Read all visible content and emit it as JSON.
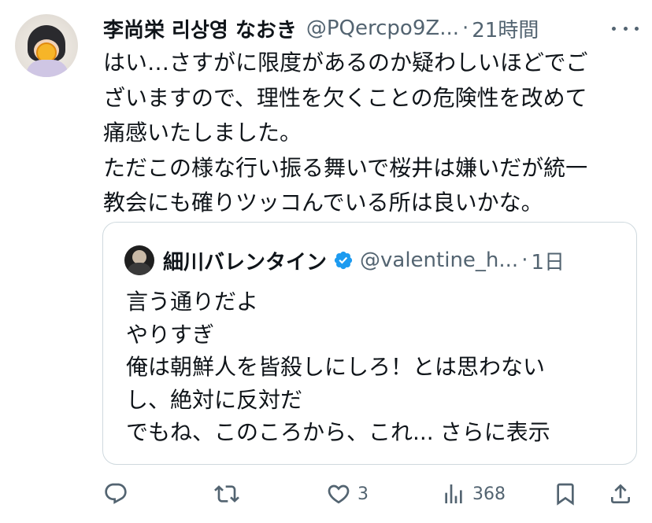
{
  "tweet": {
    "author_name": "李尚栄 리상영 なおき",
    "author_handle": "@PQercpo9Z...",
    "separator": "·",
    "time": "21時間",
    "text": "はい…さすがに限度があるのか疑わしいほどでご\nざいますので、理性を欠くことの危険性を改めて\n痛感いたしました。\nただこの様な行い振る舞いで桜井は嫌いだが統一\n教会にも確りツッコんでいる所は良いかな。"
  },
  "quote": {
    "author_name": "細川バレンタイン",
    "author_handle": "@valentine_h...",
    "separator": "·",
    "time": "1日",
    "text": "言う通りだよ\nやりすぎ\n俺は朝鮮人を皆殺しにしろ！とは思わない\nし、絶対に反対だ\nでもね、このころから、これ...",
    "show_more": "さらに表示"
  },
  "actions": {
    "reply": {
      "icon": "reply-icon",
      "count": ""
    },
    "retweet": {
      "icon": "retweet-icon",
      "count": ""
    },
    "like": {
      "icon": "heart-icon",
      "count": "3"
    },
    "views": {
      "icon": "views-icon",
      "count": "368"
    },
    "bookmark": {
      "icon": "bookmark-icon"
    },
    "share": {
      "icon": "share-icon"
    }
  },
  "colors": {
    "text": "#0f1419",
    "secondary": "#536471",
    "border": "#cfd9de",
    "verified": "#1d9bf0"
  }
}
